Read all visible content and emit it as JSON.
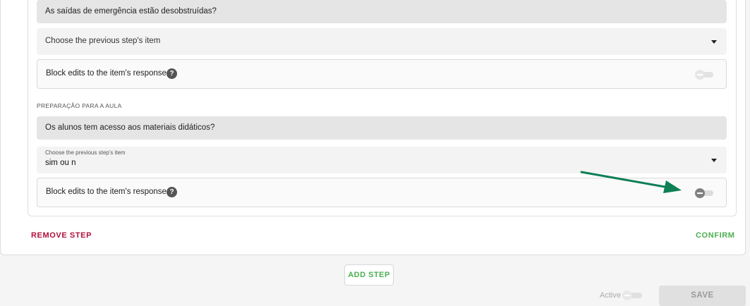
{
  "steps": [
    {
      "question": "As saídas de emergência estão desobstruídas?",
      "select_placeholder": "Choose the previous step's item",
      "block_label": "Block edits to the item's response",
      "help_glyph": "?"
    },
    {
      "section_label": "PREPARAÇÃO PARA A AULA",
      "question": "Os alunos tem acesso aos materiais didáticos?",
      "select_label": "Choose the previous step's item",
      "select_value": "sim ou n",
      "block_label": "Block edits to the item's response",
      "help_glyph": "?"
    }
  ],
  "actions": {
    "remove_step": "REMOVE STEP",
    "confirm": "CONFIRM",
    "add_step": "ADD STEP"
  },
  "footer": {
    "active_label": "Active",
    "save_label": "SAVE"
  },
  "colors": {
    "accent_green": "#4caf50",
    "danger_red": "#b0103b",
    "annotation_arrow": "#0f7f55"
  },
  "icons": {
    "help": "question-circle-icon",
    "dropdown": "caret-down-icon",
    "annotation": "arrow-annotation-icon"
  }
}
